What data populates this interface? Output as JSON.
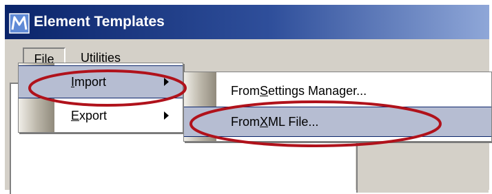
{
  "window": {
    "title": "Element Templates"
  },
  "menubar": {
    "file": {
      "pre": "",
      "mnemonic": "F",
      "post": "ile"
    },
    "utilities": {
      "pre": "",
      "mnemonic": "U",
      "post": "tilities"
    }
  },
  "file_menu": [
    {
      "pre": "",
      "mnemonic": "I",
      "post": "mport",
      "has_submenu": true,
      "highlighted": true
    },
    {
      "pre": "",
      "mnemonic": "E",
      "post": "xport",
      "has_submenu": true,
      "highlighted": false
    }
  ],
  "import_submenu": [
    {
      "pre": "From ",
      "mnemonic": "S",
      "post": "ettings Manager...",
      "highlighted": false
    },
    {
      "pre": "From ",
      "mnemonic": "X",
      "post": "ML File...",
      "highlighted": true
    }
  ],
  "colors": {
    "titlebar_start": "#0a246a",
    "titlebar_end": "#8fa7d8",
    "menu_highlight": "#b6bdd2",
    "callout": "#b0121b",
    "face": "#d4d0c8"
  },
  "icons": {
    "app": "microstation-m-icon",
    "submenu": "submenu-arrow-icon"
  }
}
